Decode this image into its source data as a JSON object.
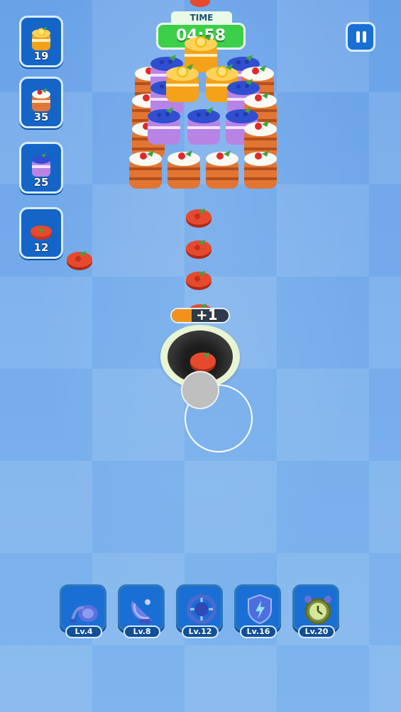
{
  "timer": {
    "label": "TIME",
    "value": "04:58"
  },
  "goals": [
    {
      "item": "orange-cake",
      "count": "19"
    },
    {
      "item": "cherry-cake",
      "count": "35"
    },
    {
      "item": "blueberry-cake",
      "count": "25"
    },
    {
      "item": "cherry-tart",
      "count": "12"
    }
  ],
  "hole": {
    "progress_fraction": 0.35,
    "gain_text": "+1"
  },
  "powerups": [
    {
      "name": "vacuum",
      "level": "Lv.4"
    },
    {
      "name": "radar",
      "level": "Lv.8"
    },
    {
      "name": "magnet-target",
      "level": "Lv.12"
    },
    {
      "name": "shield",
      "level": "Lv.16"
    },
    {
      "name": "clock",
      "level": "Lv.20"
    }
  ],
  "colors": {
    "panel_blue": "#1565c8",
    "timer_green": "#3cd04a",
    "progress_orange": "#f0921c",
    "background": "#76aeec"
  }
}
